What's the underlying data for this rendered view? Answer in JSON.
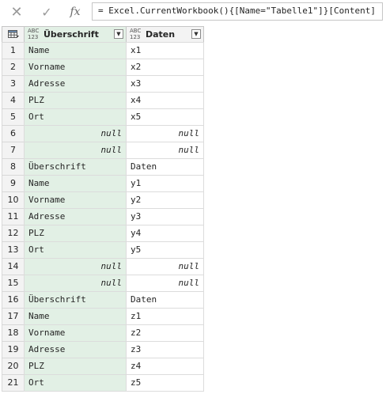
{
  "formula_bar": {
    "cancel_glyph": "✕",
    "confirm_glyph": "✓",
    "fx_label": "fx",
    "formula": "= Excel.CurrentWorkbook(){[Name=\"Tabelle1\"]}[Content]"
  },
  "table": {
    "columns": [
      {
        "type_top": "ABC",
        "type_bottom": "123",
        "name": "Überschrift"
      },
      {
        "type_top": "ABC",
        "type_bottom": "123",
        "name": "Daten"
      }
    ],
    "rows": [
      [
        "1",
        "Name",
        "x1"
      ],
      [
        "2",
        "Vorname",
        "x2"
      ],
      [
        "3",
        "Adresse",
        "x3"
      ],
      [
        "4",
        "PLZ",
        "x4"
      ],
      [
        "5",
        "Ort",
        "x5"
      ],
      [
        "6",
        "null",
        "null"
      ],
      [
        "7",
        "null",
        "null"
      ],
      [
        "8",
        "Überschrift",
        "Daten"
      ],
      [
        "9",
        "Name",
        "y1"
      ],
      [
        "10",
        "Vorname",
        "y2"
      ],
      [
        "11",
        "Adresse",
        "y3"
      ],
      [
        "12",
        "PLZ",
        "y4"
      ],
      [
        "13",
        "Ort",
        "y5"
      ],
      [
        "14",
        "null",
        "null"
      ],
      [
        "15",
        "null",
        "null"
      ],
      [
        "16",
        "Überschrift",
        "Daten"
      ],
      [
        "17",
        "Name",
        "z1"
      ],
      [
        "18",
        "Vorname",
        "z2"
      ],
      [
        "19",
        "Adresse",
        "z3"
      ],
      [
        "20",
        "PLZ",
        "z4"
      ],
      [
        "21",
        "Ort",
        "z5"
      ]
    ]
  }
}
